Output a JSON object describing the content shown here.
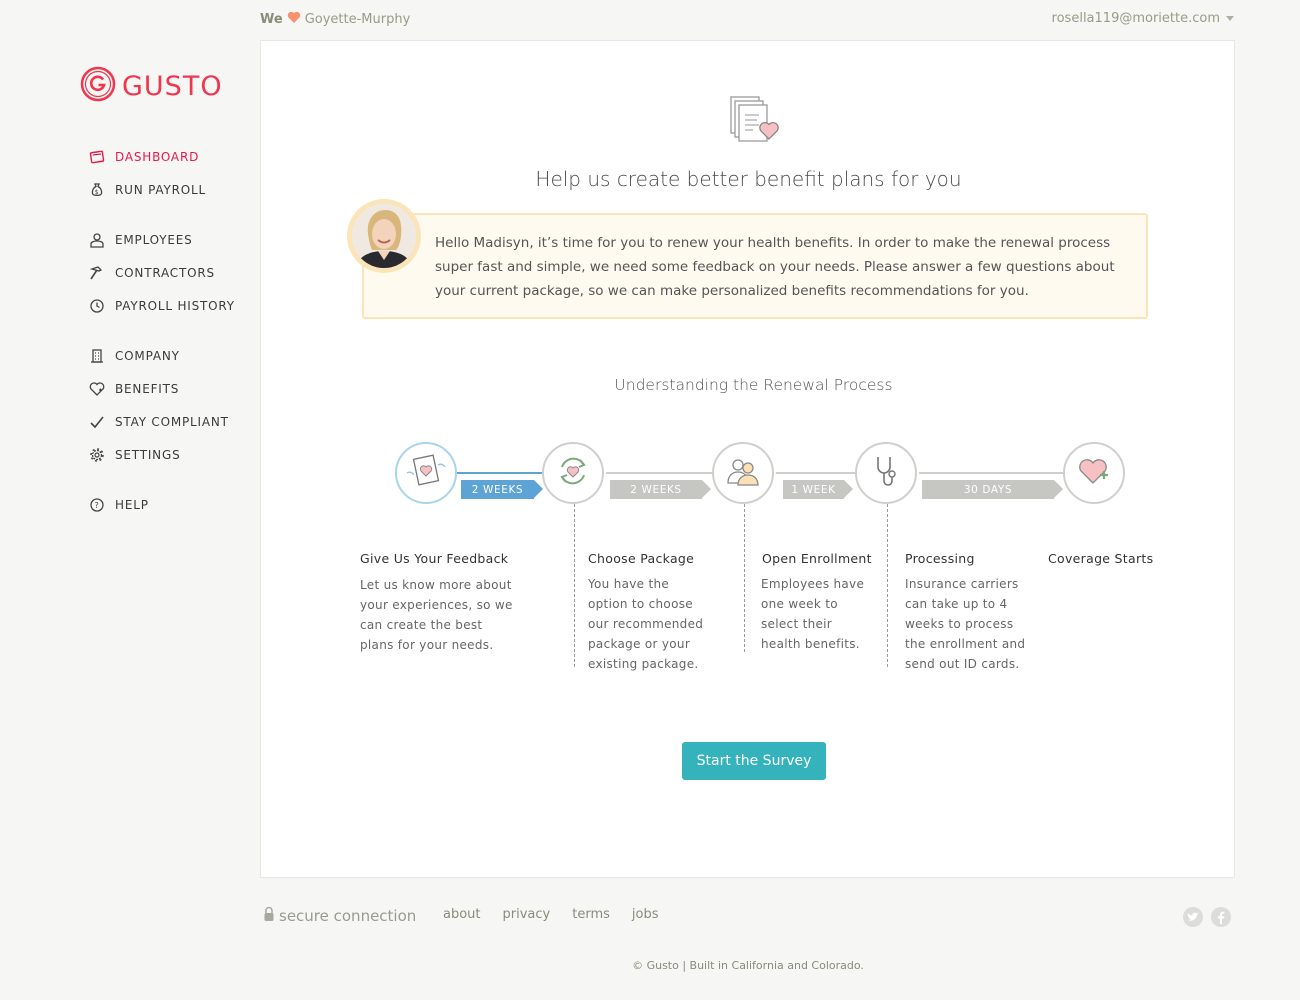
{
  "topbar": {
    "we_label": "We",
    "company": "Goyette-Murphy",
    "user_email": "rosella119@moriette.com"
  },
  "brand": {
    "name": "GUSTO",
    "color": "#f0364f"
  },
  "sidebar": {
    "items": [
      {
        "label": "DASHBOARD",
        "icon": "dashboard-icon"
      },
      {
        "label": "RUN PAYROLL",
        "icon": "money-bag-icon"
      },
      {
        "label": "EMPLOYEES",
        "icon": "person-icon"
      },
      {
        "label": "CONTRACTORS",
        "icon": "hammer-icon"
      },
      {
        "label": "PAYROLL HISTORY",
        "icon": "clock-icon"
      },
      {
        "label": "COMPANY",
        "icon": "building-icon"
      },
      {
        "label": "BENEFITS",
        "icon": "heart-icon"
      },
      {
        "label": "STAY COMPLIANT",
        "icon": "checkmark-icon"
      },
      {
        "label": "SETTINGS",
        "icon": "gear-icon"
      },
      {
        "label": "HELP",
        "icon": "question-icon"
      }
    ]
  },
  "main": {
    "headline": "Help us create better benefit plans for you",
    "message": "Hello Madisyn, it’s time for you to renew your health benefits. In order to make the renewal process super fast and simple, we need some feedback on your needs. Please answer a few questions about your current package, so we can make personalized benefits recommendations for you.",
    "subhead": "Understanding the Renewal Process",
    "durations": [
      "2 WEEKS",
      "2 WEEKS",
      "1 WEEK",
      "30 DAYS"
    ],
    "steps": [
      {
        "title": "Give Us Your Feedback",
        "desc": "Let us know more about your experiences, so we can create the best plans for your needs.",
        "icon": "feedback-card-icon"
      },
      {
        "title": "Choose Package",
        "desc": "You have the option to choose our recommended package or your existing package.",
        "icon": "refresh-heart-icon"
      },
      {
        "title": "Open Enrollment",
        "desc": "Employees have one week to select their health benefits.",
        "icon": "people-icon"
      },
      {
        "title": "Processing",
        "desc": "Insurance carriers can take up to 4 weeks to process the enrollment and send out ID cards.",
        "icon": "stethoscope-icon"
      },
      {
        "title": "Coverage Starts",
        "desc": "",
        "icon": "heart-plus-icon"
      }
    ],
    "cta_label": "Start the Survey"
  },
  "footer": {
    "secure": "secure connection",
    "links": [
      "about",
      "privacy",
      "terms",
      "jobs"
    ],
    "copyright": "© Gusto | Built in California and Colorado."
  },
  "colors": {
    "accent": "#35b3bd",
    "active_nav": "#e8194a",
    "timeline_blue": "#5da3d6"
  }
}
